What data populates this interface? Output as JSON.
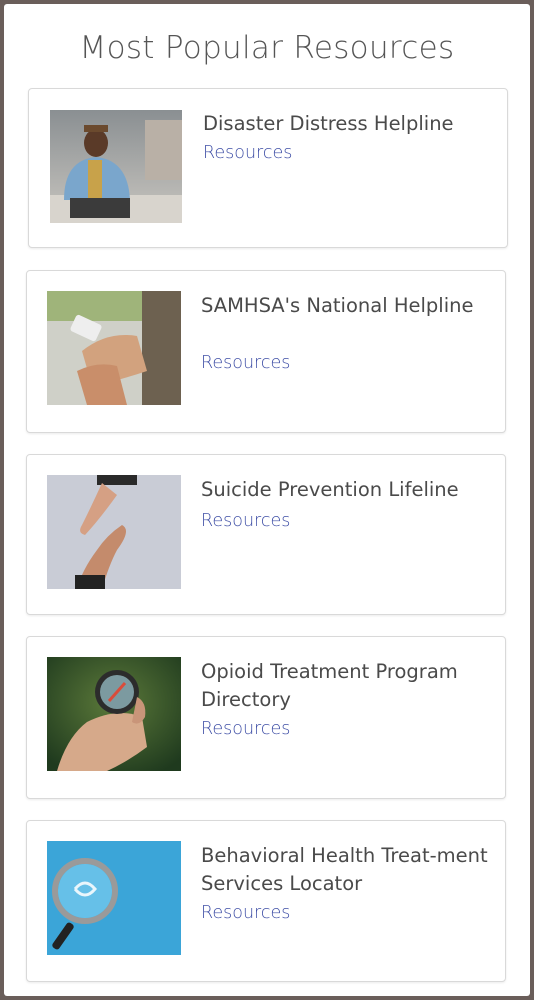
{
  "page": {
    "title": "Most Popular Resources"
  },
  "cards": [
    {
      "title": "Disaster Distress Helpline",
      "link_label": "Resources",
      "image_icon": "man-sitting-photo"
    },
    {
      "title": "SAMHSA's National Helpline",
      "link_label": "Resources",
      "image_icon": "hands-phone-photo"
    },
    {
      "title": "Suicide Prevention Lifeline",
      "link_label": "Resources",
      "image_icon": "reaching-hands-photo"
    },
    {
      "title": "Opioid Treatment Program Directory",
      "link_label": "Resources",
      "image_icon": "compass-in-hand-photo"
    },
    {
      "title": "Behavioral Health Treat-ment Services Locator",
      "link_label": "Resources",
      "image_icon": "magnifying-glass-photo"
    }
  ],
  "colors": {
    "link": "#3f4fa6",
    "title_text": "#4a4a4a",
    "frame_border": "#6a5e5a"
  }
}
